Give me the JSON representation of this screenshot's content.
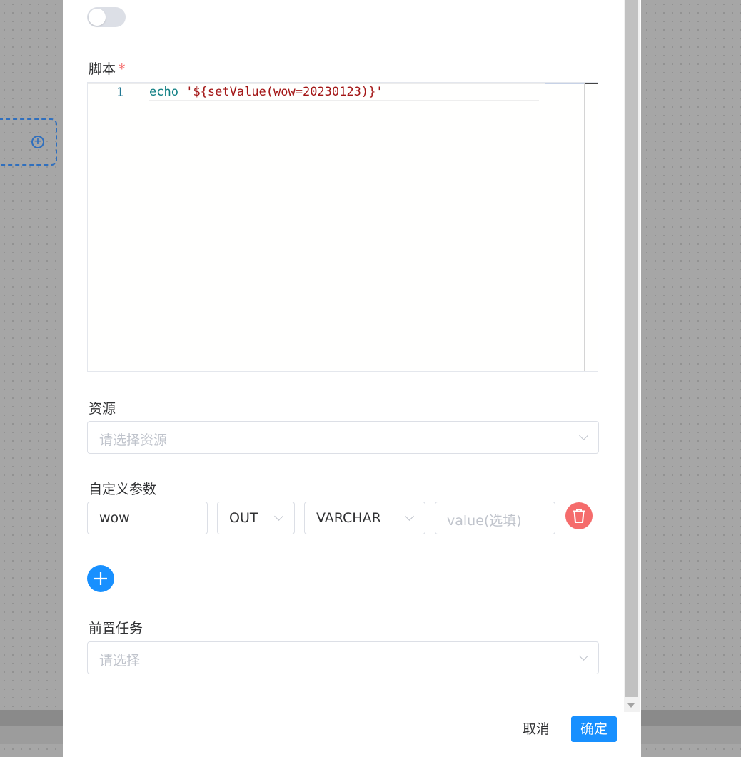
{
  "form": {
    "toggle_on": false,
    "script": {
      "label": "脚本",
      "required_mark": "*",
      "line_number": "1",
      "code_keyword": "echo",
      "code_string": "'${setValue(wow=20230123)}'"
    },
    "resource": {
      "label": "资源",
      "placeholder": "请选择资源"
    },
    "custom_params": {
      "label": "自定义参数",
      "rows": [
        {
          "name": "wow",
          "direction": "OUT",
          "type": "VARCHAR",
          "value_placeholder": "value(选填)"
        }
      ]
    },
    "pre_task": {
      "label": "前置任务",
      "placeholder": "请选择"
    }
  },
  "footer": {
    "cancel_label": "取消",
    "confirm_label": "确定"
  },
  "colors": {
    "primary": "#1890ff",
    "danger": "#f56c6c",
    "required": "#f56c6c"
  },
  "icons": {
    "delete": "trash-icon",
    "add": "plus-icon",
    "dropdown": "chevron-down-icon"
  }
}
